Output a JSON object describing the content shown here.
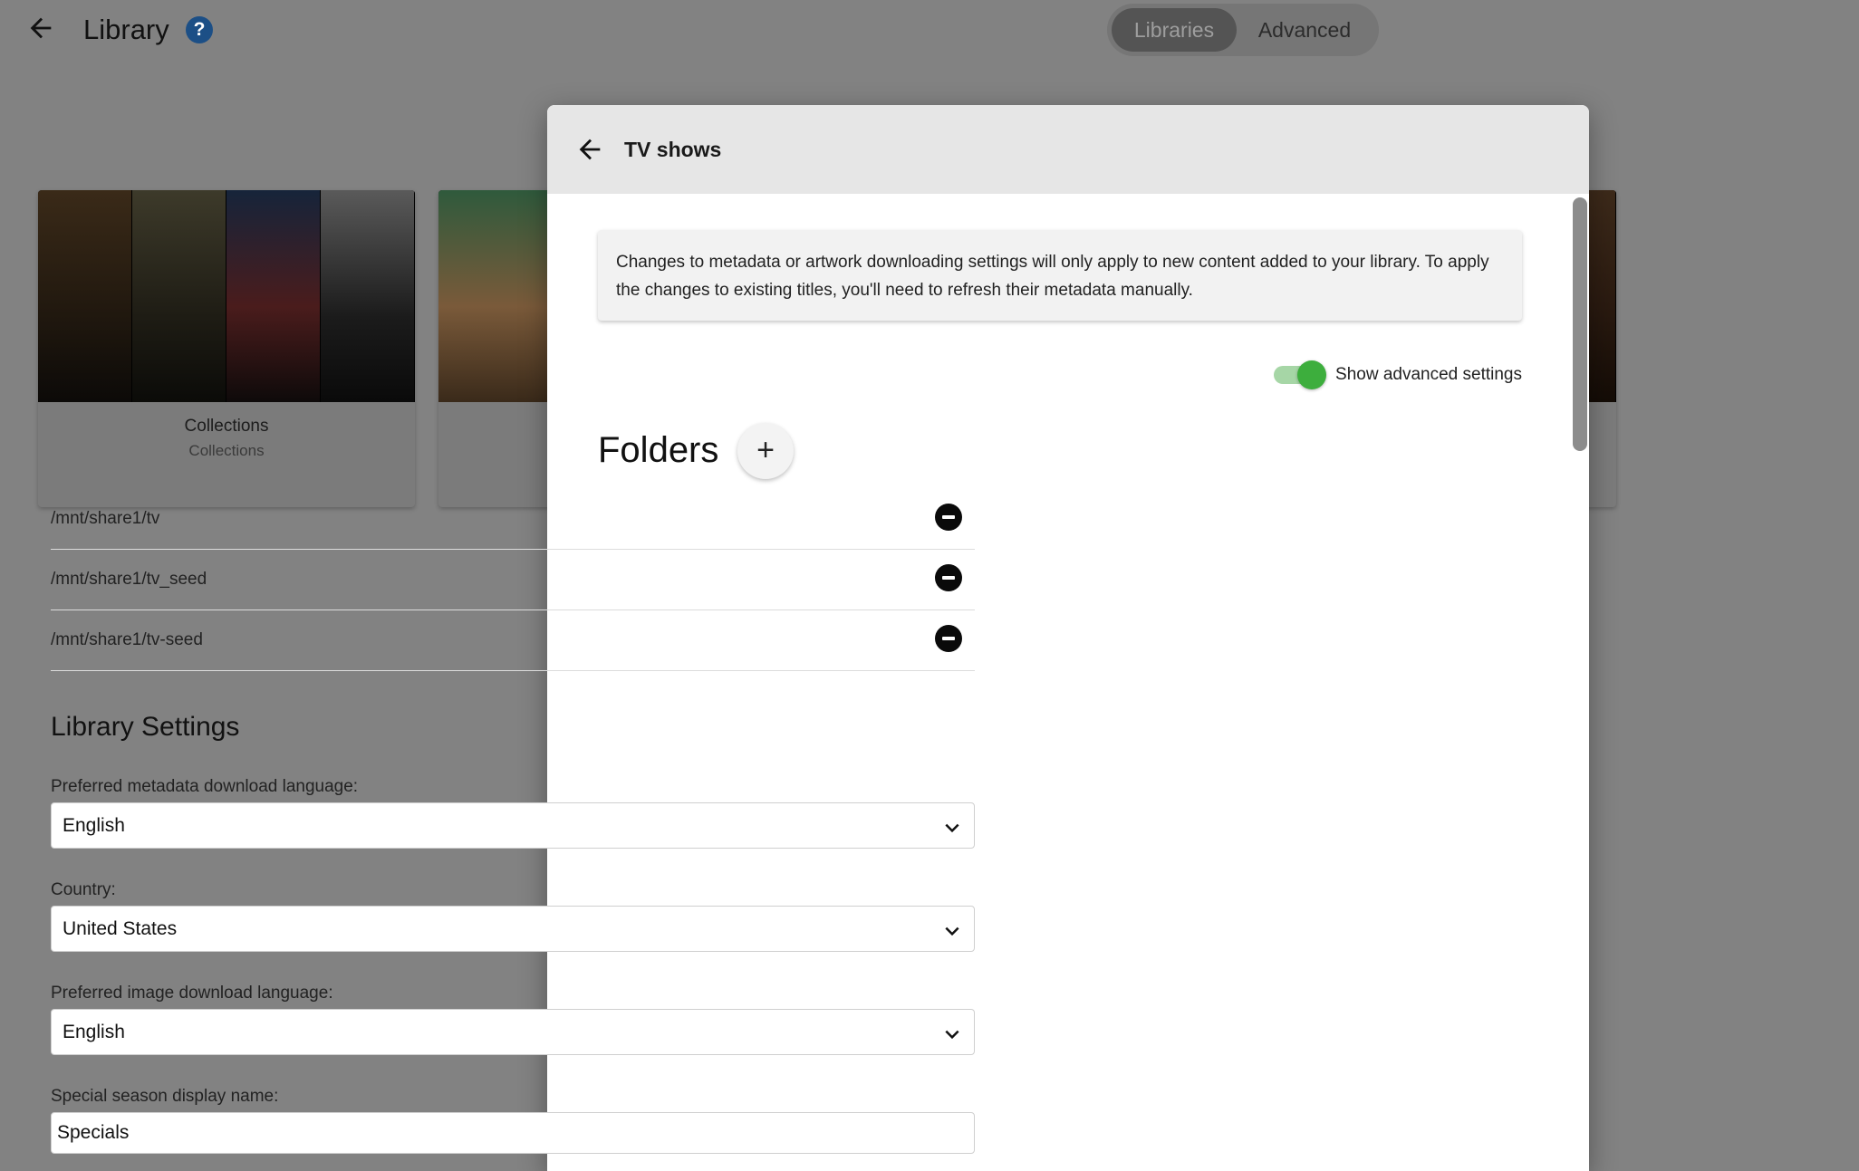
{
  "page": {
    "title": "Library",
    "back_icon": "arrow-left-icon",
    "help_icon": "help-icon",
    "help_glyph": "?",
    "tabs": [
      {
        "label": "Libraries",
        "active": true
      },
      {
        "label": "Advanced",
        "active": false
      }
    ]
  },
  "cards": [
    {
      "name": "Collections",
      "subtitle": "Collections"
    }
  ],
  "modal": {
    "title": "TV shows",
    "info": "Changes to metadata or artwork downloading settings will only apply to new content added to your library. To apply the changes to existing titles, you'll need to refresh their metadata manually.",
    "advanced_toggle": {
      "label": "Show advanced settings",
      "on": true
    },
    "folders": {
      "heading": "Folders",
      "add_glyph": "+",
      "items": [
        "/mnt/share1/tv",
        "/mnt/share1/tv_seed",
        "/mnt/share1/tv-seed"
      ]
    },
    "library_settings": {
      "heading": "Library Settings",
      "metadata_language": {
        "label": "Preferred metadata download language:",
        "value": "English"
      },
      "country": {
        "label": "Country:",
        "value": "United States"
      },
      "image_language": {
        "label": "Preferred image download language:",
        "value": "English"
      },
      "special_season": {
        "label": "Special season display name:",
        "value": "Specials"
      }
    }
  },
  "colors": {
    "toggle_on": "#3dae3d",
    "help_badge": "#1c4f86",
    "overlay": "#828282"
  }
}
